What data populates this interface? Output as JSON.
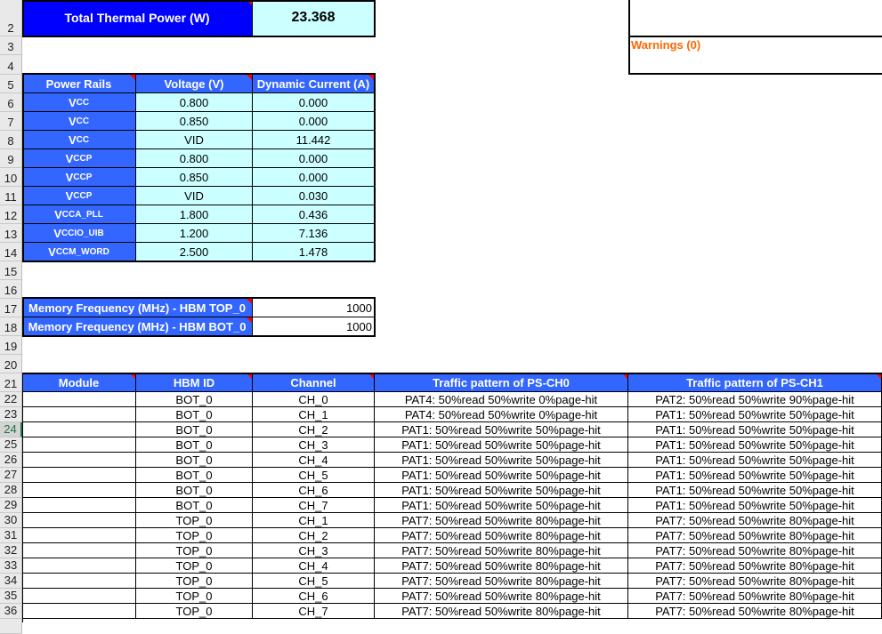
{
  "total_power": {
    "label": "Total Thermal Power (W)",
    "value": "23.368"
  },
  "warnings": {
    "label": "Warnings (0)",
    "color": "#ff6600"
  },
  "colors": {
    "header_blue": "#3366ff",
    "title_blue": "#0000ff",
    "value_cyan": "#ccffff"
  },
  "power_rails": {
    "headers": [
      "Power Rails",
      "Voltage (V)",
      "Dynamic Current (A)"
    ],
    "rows": [
      {
        "rail": "V",
        "sub": "CC",
        "voltage": "0.800",
        "current": "0.000"
      },
      {
        "rail": "V",
        "sub": "CC",
        "voltage": "0.850",
        "current": "0.000"
      },
      {
        "rail": "V",
        "sub": "CC",
        "voltage": "VID",
        "current": "11.442"
      },
      {
        "rail": "V",
        "sub": "CCP",
        "voltage": "0.800",
        "current": "0.000"
      },
      {
        "rail": "V",
        "sub": "CCP",
        "voltage": "0.850",
        "current": "0.000"
      },
      {
        "rail": "V",
        "sub": "CCP",
        "voltage": "VID",
        "current": "0.030"
      },
      {
        "rail": "V",
        "sub": "CCA_PLL",
        "voltage": "1.800",
        "current": "0.436"
      },
      {
        "rail": "V",
        "sub": "CCIO_UIB",
        "voltage": "1.200",
        "current": "7.136"
      },
      {
        "rail": "V",
        "sub": "CCM_WORD",
        "voltage": "2.500",
        "current": "1.478"
      }
    ]
  },
  "memory_frequency": [
    {
      "label": "Memory Frequency (MHz) - HBM TOP_0",
      "value": "1000"
    },
    {
      "label": "Memory Frequency (MHz) - HBM BOT_0",
      "value": "1000"
    }
  ],
  "traffic": {
    "headers": [
      "Module",
      "HBM ID",
      "Channel",
      "Traffic pattern of PS-CH0",
      "Traffic pattern of PS-CH1"
    ],
    "rows": [
      [
        "",
        "BOT_0",
        "CH_0",
        "PAT4: 50%read 50%write 0%page-hit",
        "PAT2: 50%read 50%write 90%page-hit"
      ],
      [
        "",
        "BOT_0",
        "CH_1",
        "PAT4: 50%read 50%write 0%page-hit",
        "PAT1: 50%read 50%write 50%page-hit"
      ],
      [
        "",
        "BOT_0",
        "CH_2",
        "PAT1: 50%read 50%write 50%page-hit",
        "PAT1: 50%read 50%write 50%page-hit"
      ],
      [
        "",
        "BOT_0",
        "CH_3",
        "PAT1: 50%read 50%write 50%page-hit",
        "PAT1: 50%read 50%write 50%page-hit"
      ],
      [
        "",
        "BOT_0",
        "CH_4",
        "PAT1: 50%read 50%write 50%page-hit",
        "PAT1: 50%read 50%write 50%page-hit"
      ],
      [
        "",
        "BOT_0",
        "CH_5",
        "PAT1: 50%read 50%write 50%page-hit",
        "PAT1: 50%read 50%write 50%page-hit"
      ],
      [
        "",
        "BOT_0",
        "CH_6",
        "PAT1: 50%read 50%write 50%page-hit",
        "PAT1: 50%read 50%write 50%page-hit"
      ],
      [
        "",
        "BOT_0",
        "CH_7",
        "PAT1: 50%read 50%write 50%page-hit",
        "PAT1: 50%read 50%write 50%page-hit"
      ],
      [
        "",
        "TOP_0",
        "CH_1",
        "PAT7: 50%read 50%write 80%page-hit",
        "PAT7: 50%read 50%write 80%page-hit"
      ],
      [
        "",
        "TOP_0",
        "CH_2",
        "PAT7: 50%read 50%write 80%page-hit",
        "PAT7: 50%read 50%write 80%page-hit"
      ],
      [
        "",
        "TOP_0",
        "CH_3",
        "PAT7: 50%read 50%write 80%page-hit",
        "PAT7: 50%read 50%write 80%page-hit"
      ],
      [
        "",
        "TOP_0",
        "CH_4",
        "PAT7: 50%read 50%write 80%page-hit",
        "PAT7: 50%read 50%write 80%page-hit"
      ],
      [
        "",
        "TOP_0",
        "CH_5",
        "PAT7: 50%read 50%write 80%page-hit",
        "PAT7: 50%read 50%write 80%page-hit"
      ],
      [
        "",
        "TOP_0",
        "CH_6",
        "PAT7: 50%read 50%write 80%page-hit",
        "PAT7: 50%read 50%write 80%page-hit"
      ],
      [
        "",
        "TOP_0",
        "CH_7",
        "PAT7: 50%read 50%write 80%page-hit",
        "PAT7: 50%read 50%write 80%page-hit"
      ]
    ]
  },
  "row_headers": [
    "2",
    "3",
    "4",
    "5",
    "6",
    "7",
    "8",
    "9",
    "10",
    "11",
    "12",
    "13",
    "14",
    "15",
    "16",
    "17",
    "18",
    "19",
    "20",
    "21",
    "22",
    "23",
    "24",
    "25",
    "26",
    "27",
    "28",
    "29",
    "30",
    "31",
    "32",
    "33",
    "34",
    "35",
    "36",
    ""
  ],
  "selected_row": "24"
}
